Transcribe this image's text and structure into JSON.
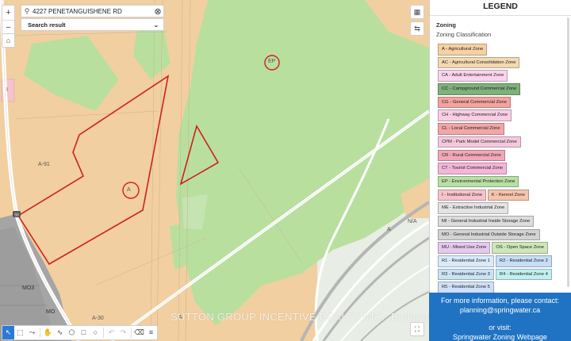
{
  "search": {
    "value": "4227 PENETANGUISHENE RD",
    "result_label": "Search result"
  },
  "map": {
    "labels": [
      "EP",
      "A",
      "A-91",
      "A-30",
      "MO",
      "MO3",
      "I",
      "N/A",
      "A",
      "A"
    ],
    "road_label": "93",
    "watermark": "SUTTON GROUP INCENTIVE REALTY INC., Brokerage"
  },
  "legend": {
    "title": "LEGEND",
    "heading": "Zoning",
    "subheading": "Zoning Classification",
    "rows": [
      [
        {
          "label": "A - Agricultural Zone",
          "color": "#f7d0a3"
        }
      ],
      [
        {
          "label": "AC - Agricultural Consolidation Zone",
          "color": "#f3d9b0"
        }
      ],
      [
        {
          "label": "CA - Adult Entertainment Zone",
          "color": "#f9d4ea"
        }
      ],
      [
        {
          "label": "CC - Campground Commercial Zone",
          "color": "#7fb17a"
        }
      ],
      [
        {
          "label": "CG - General Commercial Zone",
          "color": "#f4a39d"
        }
      ],
      [
        {
          "label": "CH - Highway Commercial Zone",
          "color": "#f9cde3"
        }
      ],
      [
        {
          "label": "CL - Local Commercial Zone",
          "color": "#f2a6a6"
        }
      ],
      [
        {
          "label": "CPM - Park Model Commercial Zone",
          "color": "#f5c8de"
        }
      ],
      [
        {
          "label": "CR - Rural Commercial Zone",
          "color": "#f1a7b8"
        }
      ],
      [
        {
          "label": "CT - Tourist Commercial Zone",
          "color": "#f3b6d6"
        }
      ],
      [
        {
          "label": "EP - Environmental Protection Zone",
          "color": "#b9e0a4"
        }
      ],
      [
        {
          "label": "I - Institutional Zone",
          "color": "#f7c2c9"
        },
        {
          "label": "K - Kennel Zone",
          "color": "#f6c3ab"
        }
      ],
      [
        {
          "label": "ME - Extractive Industrial Zone",
          "color": "#e3e3e3"
        }
      ],
      [
        {
          "label": "MI - General Industrial Inside Storage Zone",
          "color": "#dcdcdc"
        }
      ],
      [
        {
          "label": "MO - General Industrial Outside Storage Zone",
          "color": "#d3d3d3"
        }
      ],
      [
        {
          "label": "MU - Mixed Use Zone",
          "color": "#e6c9ee"
        },
        {
          "label": "OS - Open Space Zone",
          "color": "#cde7b8"
        }
      ],
      [
        {
          "label": "R1 - Residential Zone 1",
          "color": "#d9ebfa"
        },
        {
          "label": "R2 - Residential Zone 2",
          "color": "#c7def6"
        }
      ],
      [
        {
          "label": "R3 - Residential Zone 3",
          "color": "#c9e3f8"
        },
        {
          "label": "R4 - Residential Zone 4",
          "color": "#c0f0ef"
        }
      ],
      [
        {
          "label": "R5 - Residential Zone 5",
          "color": "#cfe0f7"
        }
      ]
    ],
    "info": {
      "line1": "For more information, please contact:",
      "email": "planning@springwater.ca",
      "line3": "or visit:",
      "line4": "Springwater Zoning Webpage"
    }
  }
}
